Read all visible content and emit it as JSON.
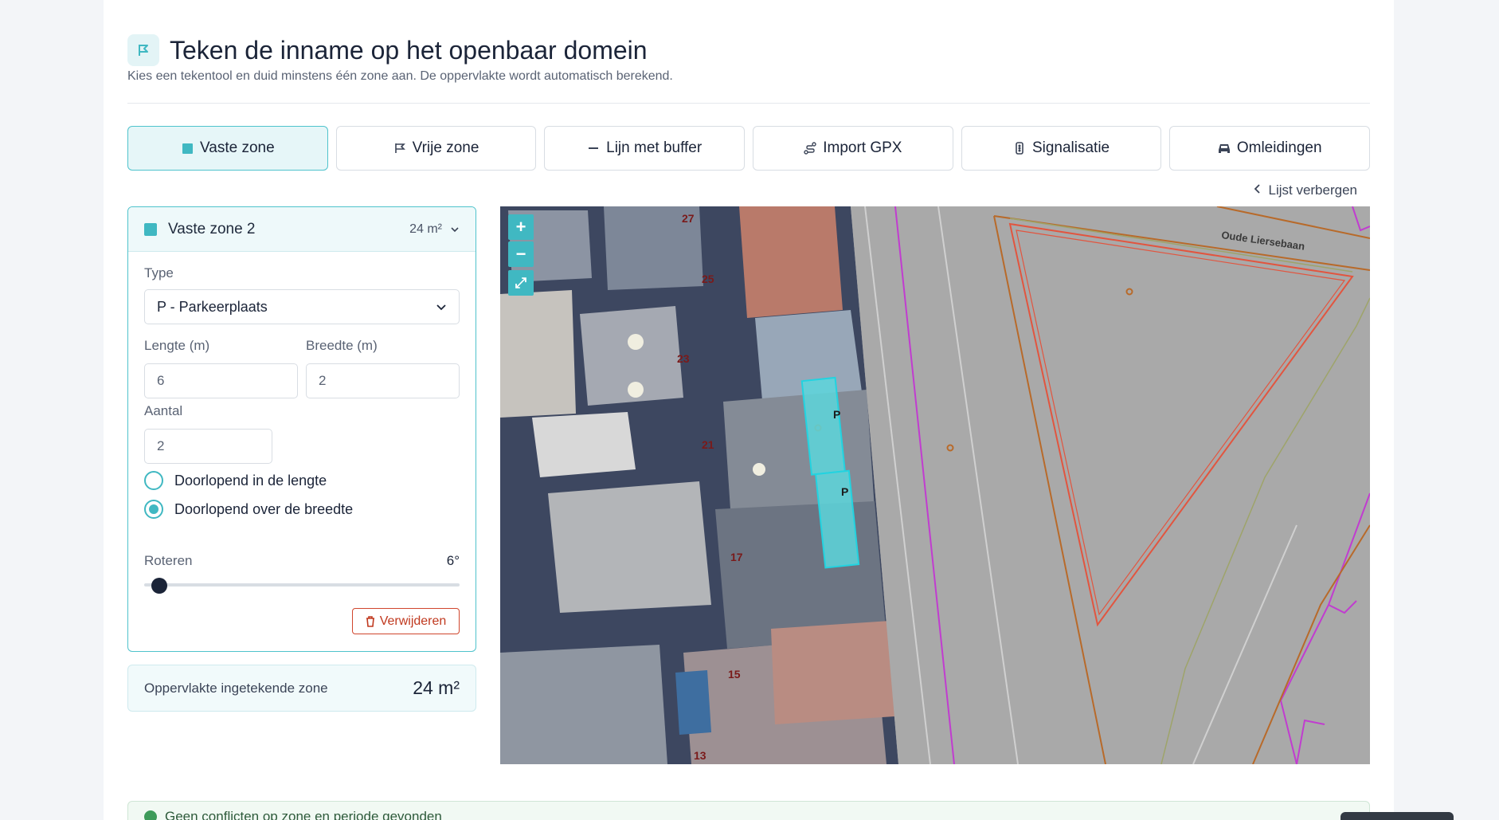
{
  "header": {
    "title": "Teken de inname op het openbaar domein",
    "subtitle": "Kies een tekentool en duid minstens één zone aan. De oppervlakte wordt automatisch berekend.",
    "icon": "flag-icon"
  },
  "tabs": [
    {
      "label": "Vaste zone",
      "icon": "square-icon",
      "active": true
    },
    {
      "label": "Vrije zone",
      "icon": "polygon-flag-icon",
      "active": false
    },
    {
      "label": "Lijn met buffer",
      "icon": "line-icon",
      "active": false
    },
    {
      "label": "Import GPX",
      "icon": "route-icon",
      "active": false
    },
    {
      "label": "Signalisatie",
      "icon": "traffic-light-icon",
      "active": false
    },
    {
      "label": "Omleidingen",
      "icon": "car-icon",
      "active": false
    }
  ],
  "hide_list_label": "Lijst verbergen",
  "zone": {
    "title": "Vaste zone 2",
    "area": "24 m²",
    "type_label": "Type",
    "type_value": "P - Parkeerplaats",
    "length_label": "Lengte (m)",
    "length_value": "6",
    "width_label": "Breedte (m)",
    "width_value": "2",
    "count_label": "Aantal",
    "count_value": "2",
    "radio_length": "Doorlopend in de lengte",
    "radio_width": "Doorlopend over de breedte",
    "selected": "width",
    "rotate_label": "Roteren",
    "rotate_value": "6°",
    "rotate_value_number": 6,
    "delete_label": "Verwijderen"
  },
  "summary": {
    "label": "Oppervlakte ingetekende zone",
    "value": "24 m²"
  },
  "map": {
    "street_name": "Oude Liersebaan",
    "house_numbers": [
      "27",
      "25",
      "23",
      "21",
      "17",
      "15",
      "13"
    ],
    "parking_labels": [
      "P",
      "P"
    ],
    "zoom_in": "+",
    "zoom_out": "−",
    "fullscreen": "⤢",
    "colors": {
      "zone": "#5cd6dc",
      "zone_border": "#22d3e0",
      "property": "#b86a2a",
      "boundary": "#c13cd0",
      "buffer": "#e2553f"
    }
  },
  "notice": "Geen conflicten op zone en periode gevonden"
}
